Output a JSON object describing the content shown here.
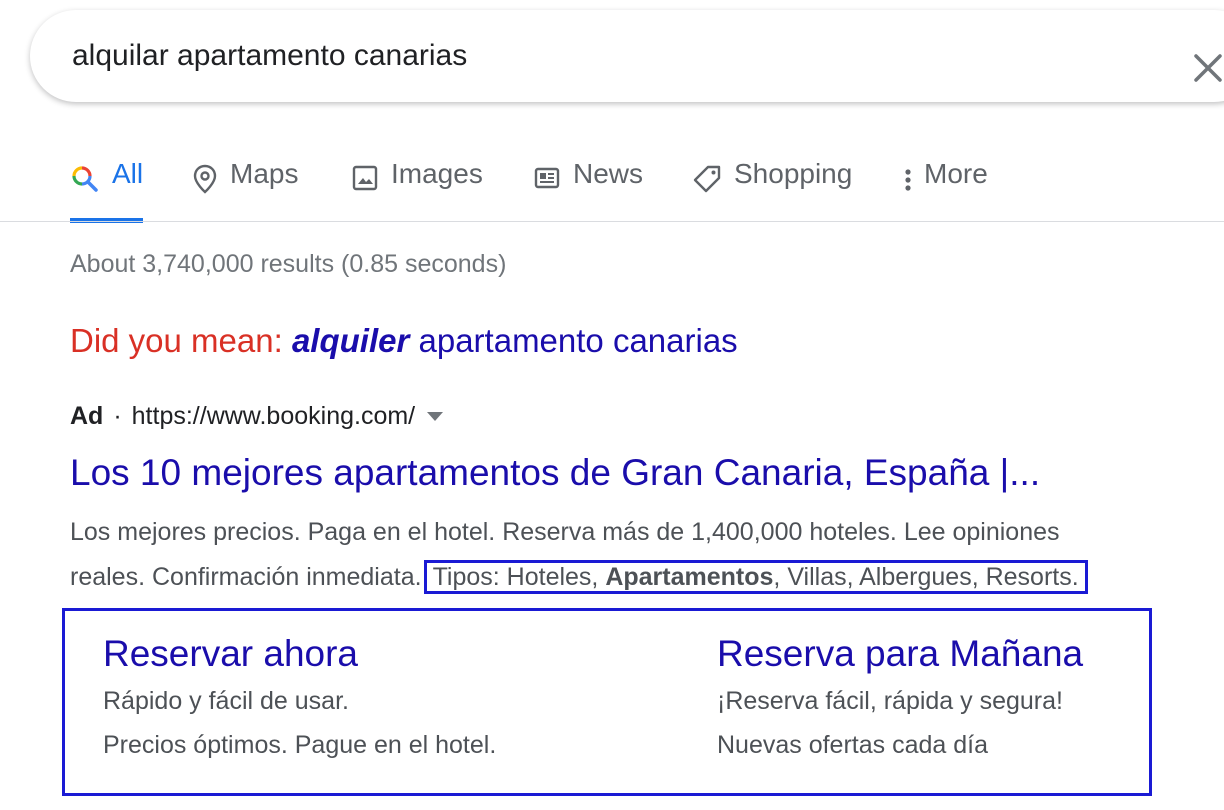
{
  "search": {
    "query": "alquilar apartamento canarias"
  },
  "tabs": [
    {
      "label": "All",
      "icon": "search-multicolor-icon",
      "active": true
    },
    {
      "label": "Maps",
      "icon": "map-pin-icon"
    },
    {
      "label": "Images",
      "icon": "image-icon"
    },
    {
      "label": "News",
      "icon": "newspaper-icon"
    },
    {
      "label": "Shopping",
      "icon": "tag-icon"
    },
    {
      "label": "More",
      "icon": "vertical-dots-icon"
    }
  ],
  "results_stats": "About 3,740,000 results (0.85 seconds)",
  "did_you_mean": {
    "label": "Did you mean: ",
    "corrected_word": "alquiler",
    "rest": " apartamento canarias"
  },
  "ad": {
    "badge": "Ad",
    "separator": "·",
    "url": "https://www.booking.com/",
    "title": "Los 10 mejores apartamentos de Gran Canaria, España |...",
    "description_line1": "Los mejores precios. Paga en el hotel. Reserva más de 1,400,000 hoteles. Lee opiniones",
    "description_line2_start": "reales. Confirmación inmediata.",
    "types_prefix": "Tipos: Hoteles, ",
    "types_bold": "Apartamentos",
    "types_suffix": ", Villas, Albergues, Resorts.",
    "sitelinks": [
      {
        "title": "Reservar ahora",
        "desc1": "Rápido y fácil de usar.",
        "desc2": "Precios óptimos. Pague en el hotel."
      },
      {
        "title": "Reserva para Mañana",
        "desc1": "¡Reserva fácil, rápida y segura!",
        "desc2": "Nuevas ofertas cada día"
      }
    ]
  },
  "colors": {
    "link": "#1a0dab",
    "active_tab": "#1a73e8",
    "did_you_mean_label": "#d93025",
    "highlight_box": "#1a1ad4"
  }
}
